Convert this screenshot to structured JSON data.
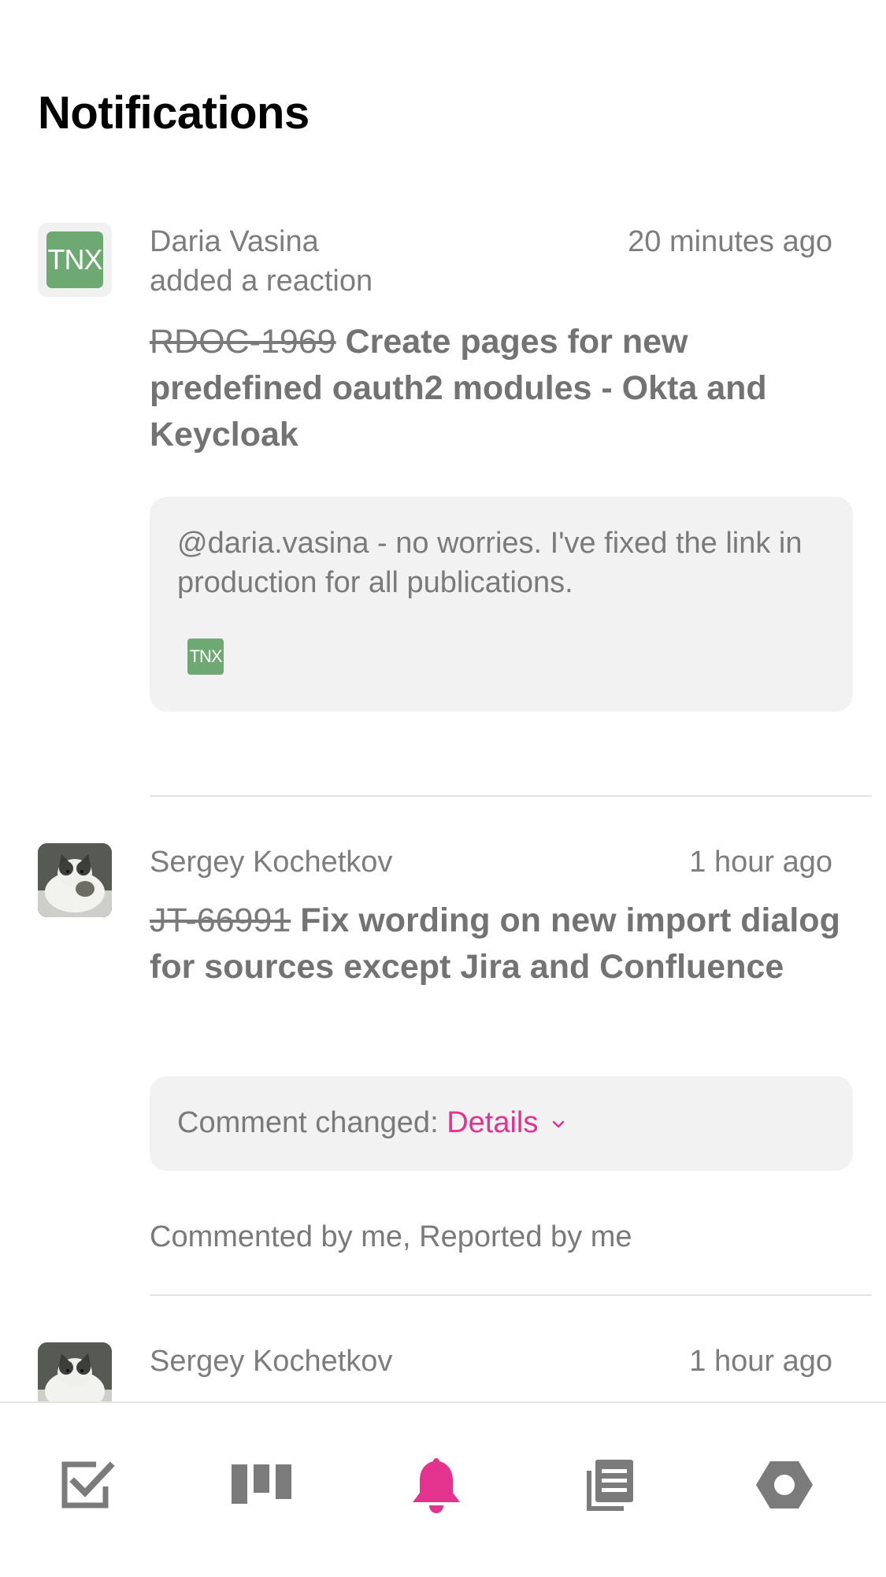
{
  "page": {
    "title": "Notifications"
  },
  "notifications": [
    {
      "author": "Daria Vasina",
      "action": "added a reaction",
      "time": "20 minutes ago",
      "issue_id": "RDOC-1969",
      "issue_title": "Create pages for new predefined oauth2 modules - Okta and Keycloak",
      "avatar": "TNX",
      "comment": "@daria.vasina - no worries. I've fixed the link in production for all publications.",
      "reaction": "TNX"
    },
    {
      "author": "Sergey Kochetkov",
      "time": "1 hour ago",
      "issue_id": "JT-66991",
      "issue_title": "Fix wording on new import dialog for sources except Jira and Confluence",
      "avatar_icon": "cat-photo-avatar",
      "change_label": "Comment changed:",
      "details_label": "Details",
      "reasons": "Commented by me, Reported by me"
    },
    {
      "author": "Sergey Kochetkov",
      "time": "1 hour ago",
      "avatar_icon": "cat-photo-avatar"
    }
  ],
  "tabbar": {
    "accent": "#e3338f",
    "inactive": "#7b7b7b",
    "tabs": [
      {
        "icon": "checkbox-icon",
        "active": false
      },
      {
        "icon": "agile-board-icon",
        "active": false
      },
      {
        "icon": "bell-icon",
        "active": true
      },
      {
        "icon": "knowledge-base-icon",
        "active": false
      },
      {
        "icon": "hexagon-settings-icon",
        "active": false
      }
    ]
  }
}
